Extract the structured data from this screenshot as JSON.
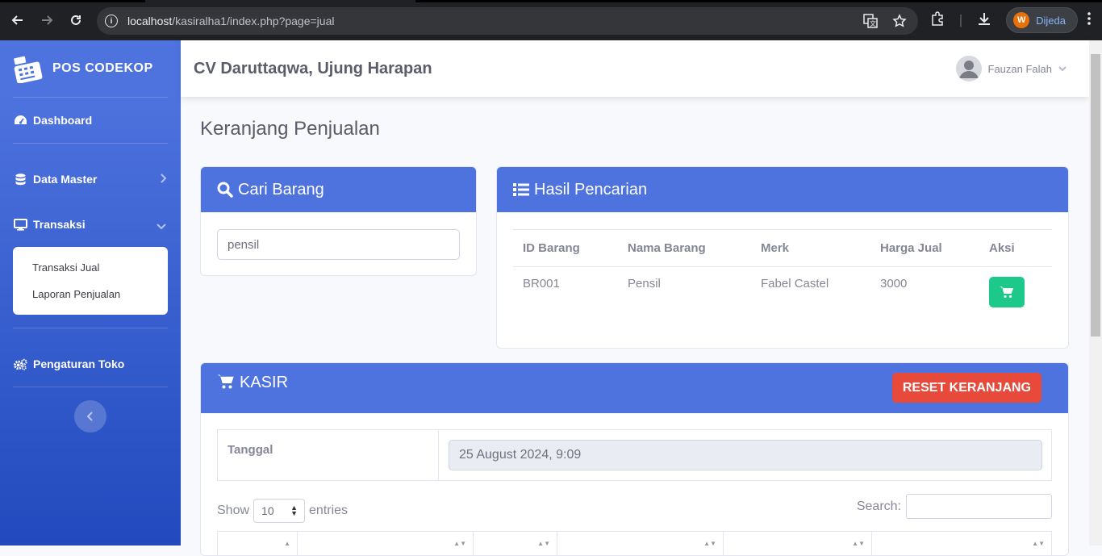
{
  "browser": {
    "url_host": "localhost",
    "url_path": "/kasiralha1/index.php?page=jual",
    "profile_initial": "W",
    "profile_name": "Dijeda"
  },
  "sidebar": {
    "brand": "POS CODEKOP",
    "items": [
      {
        "label": "Dashboard"
      },
      {
        "label": "Data Master"
      },
      {
        "label": "Transaksi"
      },
      {
        "label": "Pengaturan Toko"
      }
    ],
    "submenu": [
      "Transaksi Jual",
      "Laporan Penjualan"
    ]
  },
  "topbar": {
    "company": "CV Daruttaqwa, Ujung Harapan",
    "user": "Fauzan Falah"
  },
  "page": {
    "title": "Keranjang Penjualan"
  },
  "search_card": {
    "title": "Cari Barang",
    "value": "pensil"
  },
  "results_card": {
    "title": "Hasil Pencarian",
    "headers": [
      "ID Barang",
      "Nama Barang",
      "Merk",
      "Harga Jual",
      "Aksi"
    ],
    "rows": [
      {
        "id": "BR001",
        "nama": "Pensil",
        "merk": "Fabel Castel",
        "harga": "3000"
      }
    ]
  },
  "kasir_card": {
    "title": "KASIR",
    "reset_label": "RESET KERANJANG",
    "tanggal_label": "Tanggal",
    "tanggal_value": "25 August 2024, 9:09",
    "show_label": "Show",
    "entries_value": "10",
    "entries_label": "entries",
    "search_label": "Search:"
  },
  "colors": {
    "primary": "#4e73df",
    "success": "#1cc88a",
    "danger": "#e74a3b"
  }
}
